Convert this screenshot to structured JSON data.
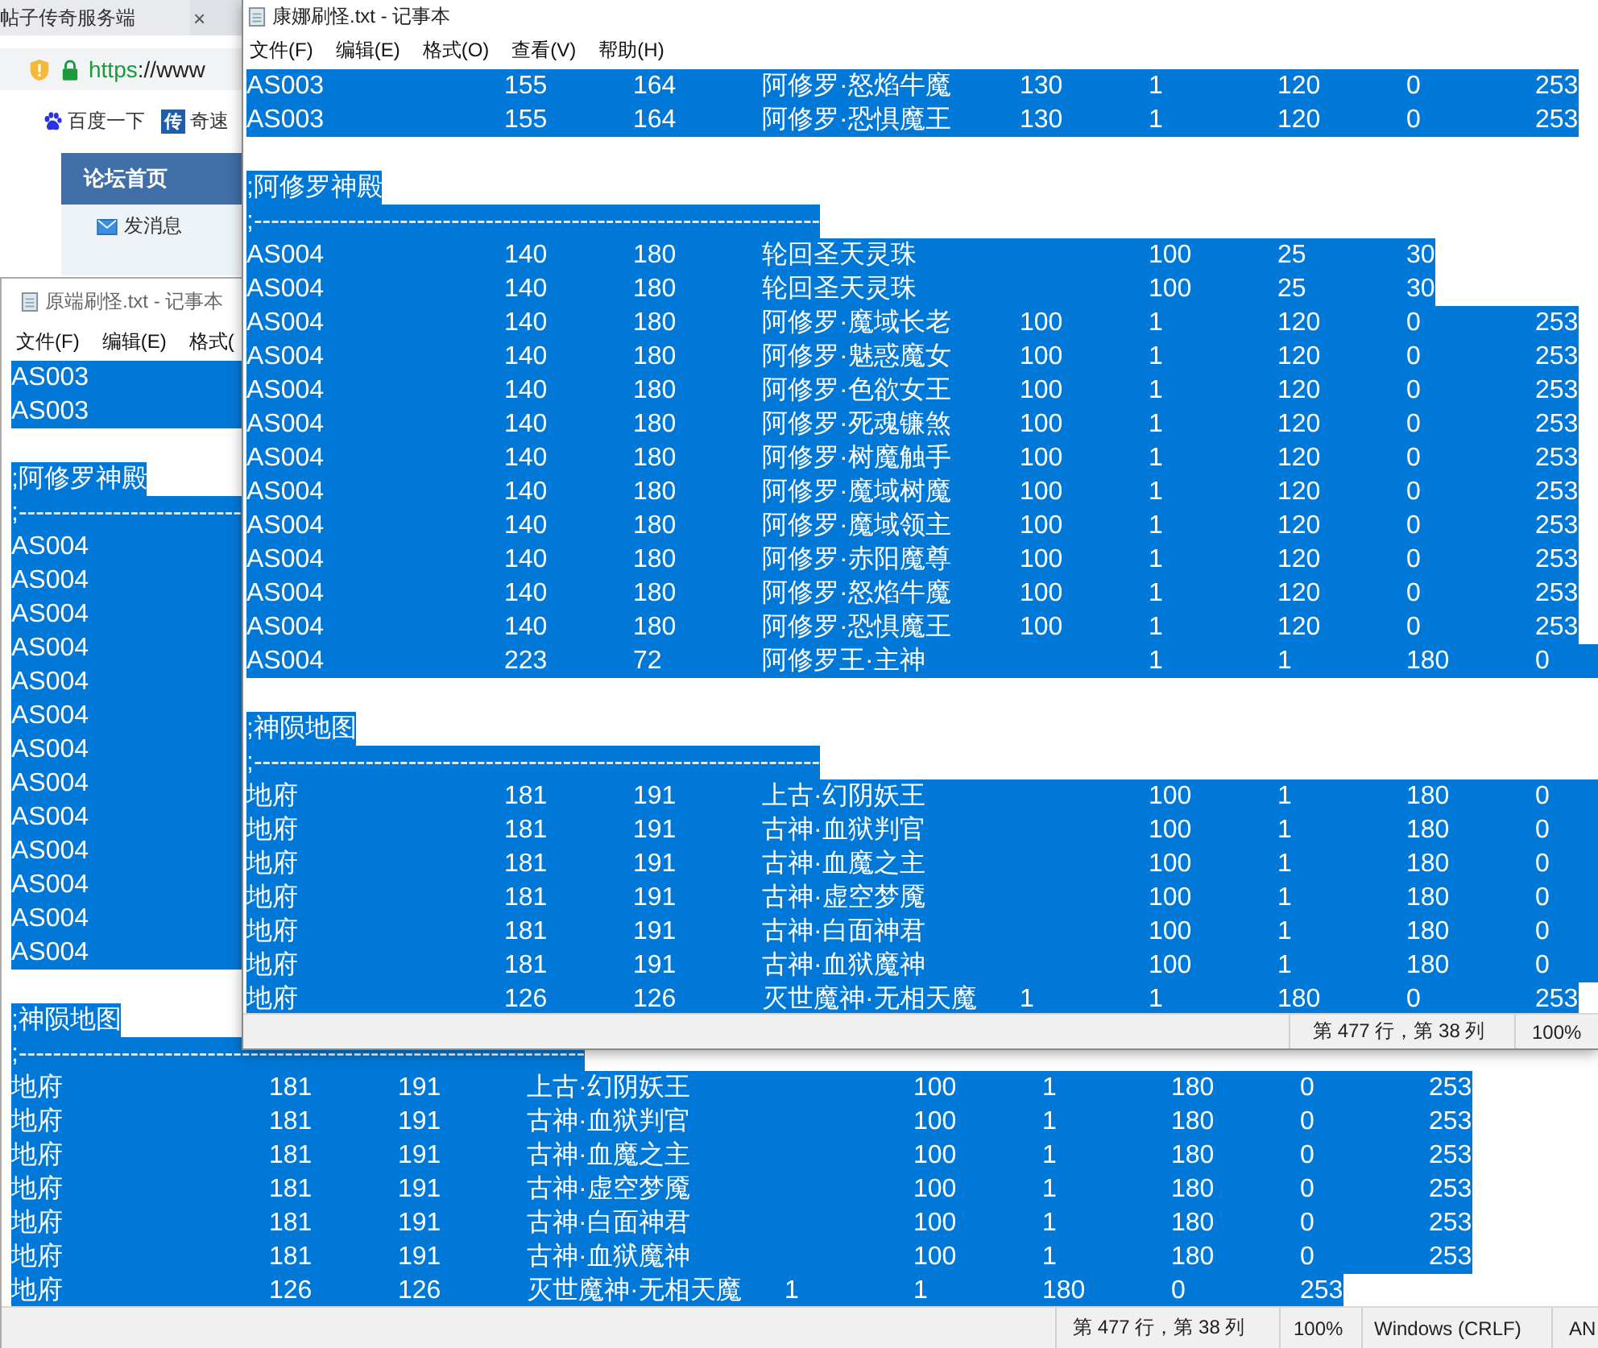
{
  "browser": {
    "tab": {
      "title": "帖子传奇服务端",
      "close": "×"
    },
    "address": {
      "scheme": "https",
      "rest": "://www"
    },
    "bookmarks": [
      {
        "label": "百度一下",
        "kind": "paw"
      },
      {
        "label": "奇速",
        "kind": "badge",
        "badge": "传"
      }
    ],
    "forum_nav": {
      "label": "论坛首页"
    },
    "message_link": "发消息"
  },
  "windows": [
    {
      "title": "康娜刷怪.txt - 记事本",
      "menu": [
        "文件(F)",
        "编辑(E)",
        "格式(O)",
        "查看(V)",
        "帮助(H)"
      ],
      "lines": [
        {
          "kind": "text",
          "selected": true,
          "runs_on": false,
          "text": "AS003\t\t155\t164\t阿修罗·怒焰牛魔\t130\t1\t120\t0\t253"
        },
        {
          "kind": "text",
          "selected": true,
          "runs_on": false,
          "text": "AS003\t\t155\t164\t阿修罗·恐惧魔王\t130\t1\t120\t0\t253"
        },
        {
          "kind": "blank"
        },
        {
          "kind": "text",
          "selected": true,
          "runs_on": false,
          "text": ";阿修罗神殿"
        },
        {
          "kind": "text",
          "selected": true,
          "runs_on": false,
          "text": ";------------------------------------------------------------------"
        },
        {
          "kind": "text",
          "selected": true,
          "runs_on": false,
          "text": "AS004\t\t140\t180\t轮回圣天灵珠\t\t100\t25\t30"
        },
        {
          "kind": "text",
          "selected": true,
          "runs_on": false,
          "text": "AS004\t\t140\t180\t轮回圣天灵珠\t\t100\t25\t30"
        },
        {
          "kind": "text",
          "selected": true,
          "runs_on": false,
          "text": "AS004\t\t140\t180\t阿修罗·魔域长老\t100\t1\t120\t0\t253"
        },
        {
          "kind": "text",
          "selected": true,
          "runs_on": false,
          "text": "AS004\t\t140\t180\t阿修罗·魅惑魔女\t100\t1\t120\t0\t253"
        },
        {
          "kind": "text",
          "selected": true,
          "runs_on": false,
          "text": "AS004\t\t140\t180\t阿修罗·色欲女王\t100\t1\t120\t0\t253"
        },
        {
          "kind": "text",
          "selected": true,
          "runs_on": false,
          "text": "AS004\t\t140\t180\t阿修罗·死魂镰煞\t100\t1\t120\t0\t253"
        },
        {
          "kind": "text",
          "selected": true,
          "runs_on": false,
          "text": "AS004\t\t140\t180\t阿修罗·树魔触手\t100\t1\t120\t0\t253"
        },
        {
          "kind": "text",
          "selected": true,
          "runs_on": false,
          "text": "AS004\t\t140\t180\t阿修罗·魔域树魔\t100\t1\t120\t0\t253"
        },
        {
          "kind": "text",
          "selected": true,
          "runs_on": false,
          "text": "AS004\t\t140\t180\t阿修罗·魔域领主\t100\t1\t120\t0\t253"
        },
        {
          "kind": "text",
          "selected": true,
          "runs_on": false,
          "text": "AS004\t\t140\t180\t阿修罗·赤阳魔尊\t100\t1\t120\t0\t253"
        },
        {
          "kind": "text",
          "selected": true,
          "runs_on": false,
          "text": "AS004\t\t140\t180\t阿修罗·怒焰牛魔\t100\t1\t120\t0\t253"
        },
        {
          "kind": "text",
          "selected": true,
          "runs_on": false,
          "text": "AS004\t\t140\t180\t阿修罗·恐惧魔王\t100\t1\t120\t0\t253"
        },
        {
          "kind": "text",
          "selected": true,
          "runs_on": true,
          "text": "AS004\t\t223\t72\t阿修罗王·主神\t\t1\t1\t180\t0"
        },
        {
          "kind": "blank"
        },
        {
          "kind": "text",
          "selected": true,
          "runs_on": false,
          "text": ";神陨地图"
        },
        {
          "kind": "text",
          "selected": true,
          "runs_on": false,
          "text": ";------------------------------------------------------------------"
        },
        {
          "kind": "text",
          "selected": true,
          "runs_on": true,
          "text": "地府\t\t181\t191\t上古·幻阴妖王\t\t100\t1\t180\t0"
        },
        {
          "kind": "text",
          "selected": true,
          "runs_on": true,
          "text": "地府\t\t181\t191\t古神·血狱判官\t\t100\t1\t180\t0"
        },
        {
          "kind": "text",
          "selected": true,
          "runs_on": true,
          "text": "地府\t\t181\t191\t古神·血魔之主\t\t100\t1\t180\t0"
        },
        {
          "kind": "text",
          "selected": true,
          "runs_on": true,
          "text": "地府\t\t181\t191\t古神·虚空梦魇\t\t100\t1\t180\t0"
        },
        {
          "kind": "text",
          "selected": true,
          "runs_on": true,
          "text": "地府\t\t181\t191\t古神·白面神君\t\t100\t1\t180\t0"
        },
        {
          "kind": "text",
          "selected": true,
          "runs_on": true,
          "text": "地府\t\t181\t191\t古神·血狱魔神\t\t100\t1\t180\t0"
        },
        {
          "kind": "text",
          "selected": true,
          "runs_on": false,
          "text": "地府\t\t126\t126\t灭世魔神·无相天魔\t1\t1\t180\t0\t253"
        }
      ],
      "status": [
        "第 477 行，第 38 列",
        "100%"
      ]
    },
    {
      "title": "原端刷怪.txt - 记事本",
      "menu": [
        "文件(F)",
        "编辑(E)",
        "格式("
      ],
      "lines": [
        {
          "kind": "text",
          "selected": true,
          "runs_on": true,
          "text": "AS003"
        },
        {
          "kind": "text",
          "selected": true,
          "runs_on": true,
          "text": "AS003"
        },
        {
          "kind": "blank"
        },
        {
          "kind": "text",
          "selected": true,
          "runs_on": false,
          "text": ";阿修罗神殿"
        },
        {
          "kind": "text",
          "selected": true,
          "runs_on": true,
          "text": ";--------------------------"
        },
        {
          "kind": "text",
          "selected": true,
          "runs_on": true,
          "text": "AS004"
        },
        {
          "kind": "text",
          "selected": true,
          "runs_on": true,
          "text": "AS004"
        },
        {
          "kind": "text",
          "selected": true,
          "runs_on": true,
          "text": "AS004"
        },
        {
          "kind": "text",
          "selected": true,
          "runs_on": true,
          "text": "AS004"
        },
        {
          "kind": "text",
          "selected": true,
          "runs_on": true,
          "text": "AS004"
        },
        {
          "kind": "text",
          "selected": true,
          "runs_on": true,
          "text": "AS004"
        },
        {
          "kind": "text",
          "selected": true,
          "runs_on": true,
          "text": "AS004"
        },
        {
          "kind": "text",
          "selected": true,
          "runs_on": true,
          "text": "AS004"
        },
        {
          "kind": "text",
          "selected": true,
          "runs_on": true,
          "text": "AS004"
        },
        {
          "kind": "text",
          "selected": true,
          "runs_on": true,
          "text": "AS004"
        },
        {
          "kind": "text",
          "selected": true,
          "runs_on": true,
          "text": "AS004"
        },
        {
          "kind": "text",
          "selected": true,
          "runs_on": true,
          "text": "AS004"
        },
        {
          "kind": "text",
          "selected": true,
          "runs_on": true,
          "text": "AS004"
        },
        {
          "kind": "blank"
        },
        {
          "kind": "text",
          "selected": true,
          "runs_on": false,
          "text": ";神陨地图"
        },
        {
          "kind": "text",
          "selected": true,
          "runs_on": false,
          "text": ";------------------------------------------------------------------"
        },
        {
          "kind": "text",
          "selected": true,
          "runs_on": false,
          "text": "地府\t\t181\t191\t上古·幻阴妖王\t\t100\t1\t180\t0\t253"
        },
        {
          "kind": "text",
          "selected": true,
          "runs_on": false,
          "text": "地府\t\t181\t191\t古神·血狱判官\t\t100\t1\t180\t0\t253"
        },
        {
          "kind": "text",
          "selected": true,
          "runs_on": false,
          "text": "地府\t\t181\t191\t古神·血魔之主\t\t100\t1\t180\t0\t253"
        },
        {
          "kind": "text",
          "selected": true,
          "runs_on": false,
          "text": "地府\t\t181\t191\t古神·虚空梦魇\t\t100\t1\t180\t0\t253"
        },
        {
          "kind": "text",
          "selected": true,
          "runs_on": false,
          "text": "地府\t\t181\t191\t古神·白面神君\t\t100\t1\t180\t0\t253"
        },
        {
          "kind": "text",
          "selected": true,
          "runs_on": false,
          "text": "地府\t\t181\t191\t古神·血狱魔神\t\t100\t1\t180\t0\t253"
        },
        {
          "kind": "text",
          "selected": true,
          "runs_on": false,
          "text": "地府\t\t126\t126\t灭世魔神·无相天魔\t1\t1\t180\t0\t253"
        }
      ],
      "status": [
        "第 477 行，第 38 列",
        "100%",
        "Windows (CRLF)",
        "AN"
      ]
    }
  ]
}
